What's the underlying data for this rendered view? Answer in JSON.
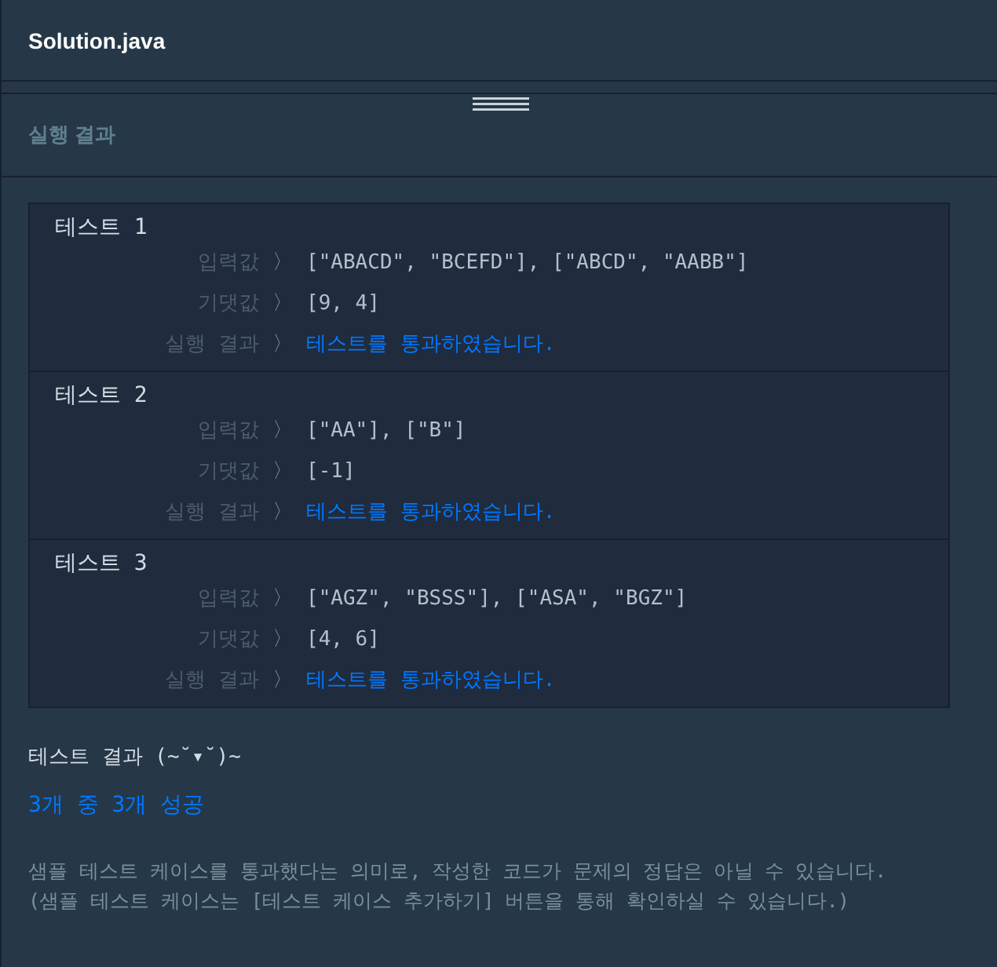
{
  "editor": {
    "filename": "Solution.java"
  },
  "panel": {
    "title": "실행 결과"
  },
  "tests": [
    {
      "title": "테스트 1",
      "rows": [
        {
          "label": "입력값",
          "separator": "〉",
          "value": "[\"ABACD\", \"BCEFD\"], [\"ABCD\", \"AABB\"]",
          "kind": "plain"
        },
        {
          "label": "기댓값",
          "separator": "〉",
          "value": "[9, 4]",
          "kind": "plain"
        },
        {
          "label": "실행 결과",
          "separator": "〉",
          "value": "테스트를 통과하였습니다.",
          "kind": "passed"
        }
      ]
    },
    {
      "title": "테스트 2",
      "rows": [
        {
          "label": "입력값",
          "separator": "〉",
          "value": "[\"AA\"], [\"B\"]",
          "kind": "plain"
        },
        {
          "label": "기댓값",
          "separator": "〉",
          "value": "[-1]",
          "kind": "plain"
        },
        {
          "label": "실행 결과",
          "separator": "〉",
          "value": "테스트를 통과하였습니다.",
          "kind": "passed"
        }
      ]
    },
    {
      "title": "테스트 3",
      "rows": [
        {
          "label": "입력값",
          "separator": "〉",
          "value": "[\"AGZ\", \"BSSS\"], [\"ASA\", \"BGZ\"]",
          "kind": "plain"
        },
        {
          "label": "기댓값",
          "separator": "〉",
          "value": "[4, 6]",
          "kind": "plain"
        },
        {
          "label": "실행 결과",
          "separator": "〉",
          "value": "테스트를 통과하였습니다.",
          "kind": "passed"
        }
      ]
    }
  ],
  "summary": {
    "heading": "테스트 결과 (~˘▾˘)~",
    "score": "3개 중 3개 성공",
    "notes": [
      "샘플 테스트 케이스를 통과했다는 의미로, 작성한 코드가 문제의 정답은 아닐 수 있습니다.",
      "(샘플 테스트 케이스는 [테스트 케이스 추가하기] 버튼을 통해 확인하실 수 있습니다.)"
    ]
  }
}
